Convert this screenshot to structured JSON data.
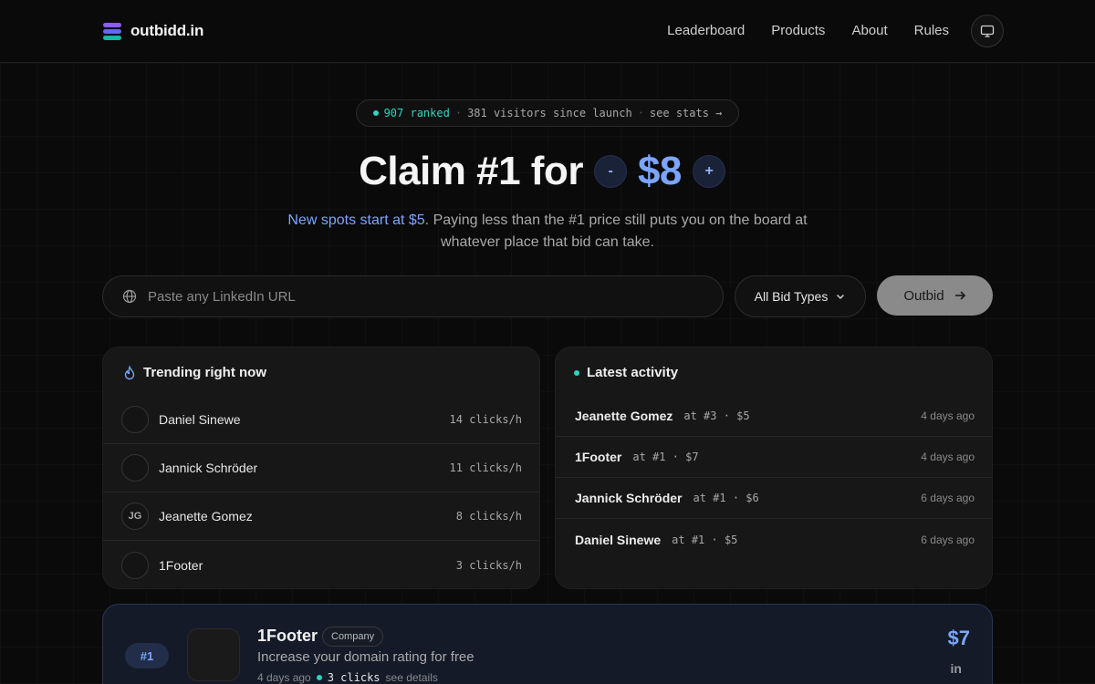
{
  "header": {
    "brand": "outbidd.in",
    "nav": [
      "Leaderboard",
      "Products",
      "About",
      "Rules"
    ]
  },
  "stats": {
    "ranked": "907 ranked",
    "visitors": "381 visitors since launch",
    "see_stats": "see stats →"
  },
  "hero": {
    "headline": "Claim #1 for",
    "minus": "-",
    "price": "$8",
    "plus": "+",
    "sub_highlight": "New spots start at $5.",
    "sub_rest": " Paying less than the #1 price still puts you on the board at whatever place that bid can take."
  },
  "search": {
    "placeholder": "Paste any LinkedIn URL",
    "bid_type": "All Bid Types",
    "outbid_label": "Outbid"
  },
  "trending": {
    "title": "Trending right now",
    "items": [
      {
        "initials": "",
        "name": "Daniel Sinewe",
        "rate": "14 clicks/h"
      },
      {
        "initials": "",
        "name": "Jannick Schröder",
        "rate": "11 clicks/h"
      },
      {
        "initials": "JG",
        "name": "Jeanette Gomez",
        "rate": "8 clicks/h"
      },
      {
        "initials": "",
        "name": "1Footer",
        "rate": "3 clicks/h"
      }
    ]
  },
  "activity": {
    "title": "Latest activity",
    "items": [
      {
        "name": "Jeanette Gomez",
        "meta": "at #3 · $5",
        "time": "4 days ago"
      },
      {
        "name": "1Footer",
        "meta": "at #1 · $7",
        "time": "4 days ago"
      },
      {
        "name": "Jannick Schröder",
        "meta": "at #1 · $6",
        "time": "6 days ago"
      },
      {
        "name": "Daniel Sinewe",
        "meta": "at #1 · $5",
        "time": "6 days ago"
      }
    ]
  },
  "top_entry": {
    "rank": "#1",
    "name": "1Footer",
    "tag": "Company",
    "description": "Increase your domain rating for free",
    "age": "4 days ago",
    "clicks": "3 clicks",
    "details": "see details",
    "price": "$7",
    "social": "in"
  },
  "colors": {
    "accent_blue": "#7ba5ff",
    "accent_teal": "#2dd4bf",
    "background": "#0a0a0a"
  }
}
